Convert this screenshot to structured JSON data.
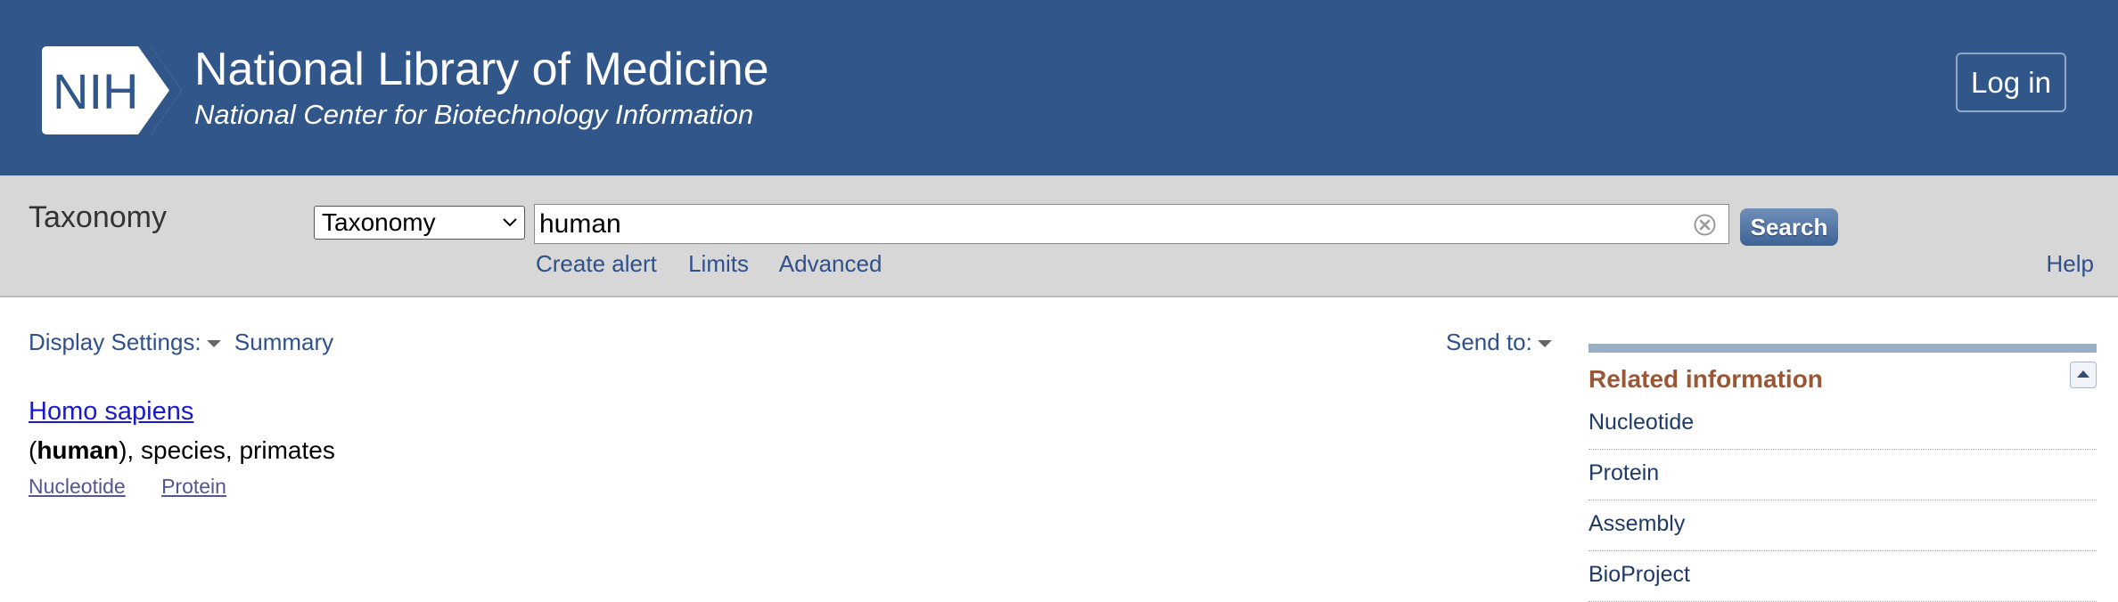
{
  "header": {
    "logo_text": "NIH",
    "title": "National Library of Medicine",
    "subtitle": "National Center for Biotechnology Information",
    "login_label": "Log in",
    "brand_color": "#30568a"
  },
  "search": {
    "db_title": "Taxonomy",
    "db_selected": "Taxonomy",
    "query": "human",
    "search_label": "Search",
    "links": [
      "Create alert",
      "Limits",
      "Advanced"
    ],
    "help_label": "Help"
  },
  "results_bar": {
    "display_settings_label": "Display Settings:",
    "display_format": "Summary",
    "send_to_label": "Send to:"
  },
  "result": {
    "title": "Homo sapiens",
    "common_name": "human",
    "desc_rest": "), species, primates",
    "links": [
      "Nucleotide",
      "Protein"
    ]
  },
  "related": {
    "heading": "Related information",
    "items": [
      "Nucleotide",
      "Protein",
      "Assembly",
      "BioProject"
    ]
  }
}
